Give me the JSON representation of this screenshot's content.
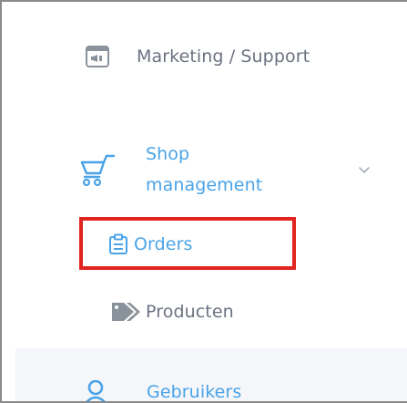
{
  "sidebar": {
    "items": [
      {
        "label": "Marketing / Support",
        "icon": "megaphone-card-icon"
      },
      {
        "label_line1": "Shop",
        "label_line2": "management",
        "icon": "shopping-cart-icon",
        "expanded": true
      },
      {
        "label": "Orders",
        "icon": "clipboard-icon",
        "highlighted": true
      },
      {
        "label": "Producten",
        "icon": "tags-icon"
      },
      {
        "label": "Gebruikers",
        "icon": "user-icon"
      }
    ]
  },
  "colors": {
    "accent": "#4aa3e8",
    "muted_text": "#6b7280",
    "highlight_border": "#e0241f"
  }
}
